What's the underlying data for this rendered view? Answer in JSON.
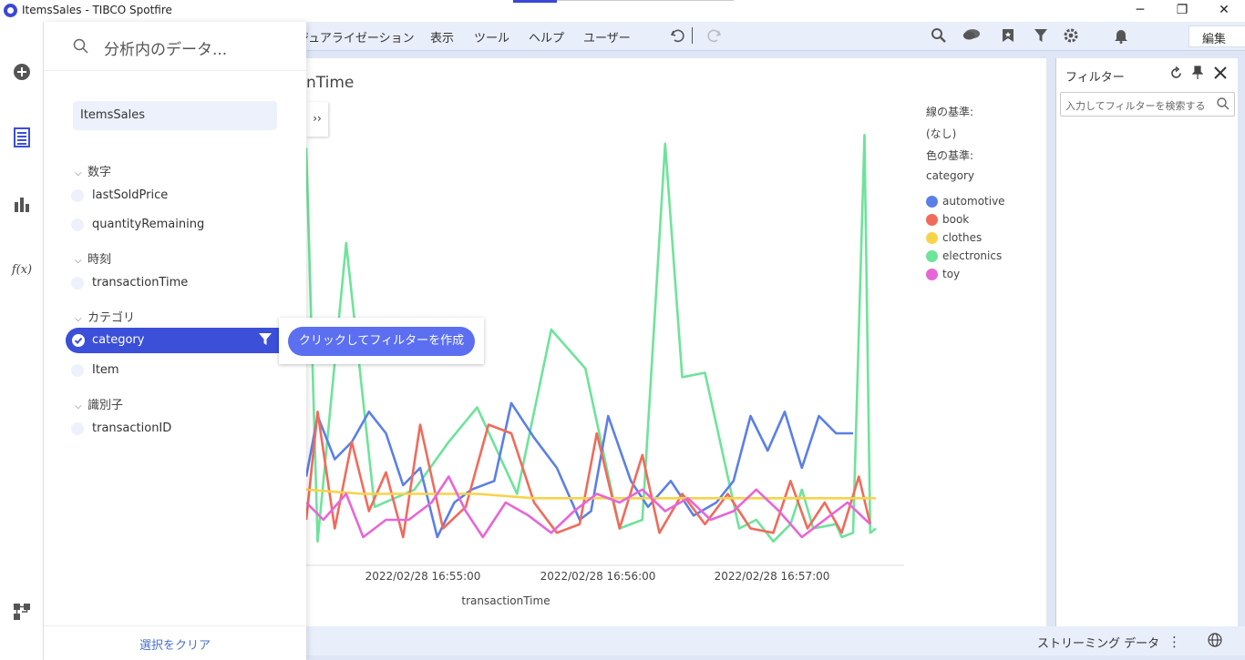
{
  "window": {
    "title": "ItemsSales - TIBCO Spotfire"
  },
  "menu": {
    "items": [
      "ジュアライゼーション",
      "表示",
      "ツール",
      "ヘルプ",
      "ユーザー"
    ],
    "edit_mode": "編集"
  },
  "data_panel": {
    "search_placeholder": "分析内のデータ...",
    "source": "ItemsSales",
    "groups": [
      {
        "label": "数字",
        "fields": [
          "lastSoldPrice",
          "quantityRemaining"
        ]
      },
      {
        "label": "時刻",
        "fields": [
          "transactionTime"
        ]
      },
      {
        "label": "カテゴリ",
        "fields": [
          "category",
          "Item"
        ]
      },
      {
        "label": "識別子",
        "fields": [
          "transactionID"
        ]
      }
    ],
    "selected_field": "category",
    "clear_selection": "選択をクリア"
  },
  "tooltip": {
    "create_filter": "クリックしてフィルターを作成"
  },
  "visualization": {
    "title": "nTime",
    "expand_label": "››",
    "legend": {
      "line_by_label": "線の基準:",
      "line_by_value": "(なし)",
      "color_by_label": "色の基準:",
      "color_by_value": "category"
    }
  },
  "filter_panel": {
    "title": "フィルター",
    "search_placeholder": "入力してフィルターを検索する"
  },
  "statusbar": {
    "streaming": "ストリーミング データ"
  },
  "chart_data": {
    "type": "line",
    "xlabel": "transactionTime",
    "ylabel": "",
    "x_ticks": [
      "2022/02/28 16:55:00",
      "2022/02/28 16:56:00",
      "2022/02/28 16:57:00"
    ],
    "colors": {
      "automotive": "#5b7fe6",
      "book": "#f06b5b",
      "clothes": "#f7d34a",
      "electronics": "#6ee39a",
      "toy": "#e766d6"
    },
    "series": [
      {
        "name": "electronics",
        "points": [
          [
            0,
            0.06
          ],
          [
            0.02,
            0.97
          ],
          [
            0.07,
            0.28
          ],
          [
            0.12,
            0.89
          ],
          [
            0.19,
            0.85
          ],
          [
            0.25,
            0.74
          ],
          [
            0.3,
            0.66
          ],
          [
            0.37,
            0.86
          ],
          [
            0.43,
            0.48
          ],
          [
            0.49,
            0.57
          ],
          [
            0.55,
            0.94
          ],
          [
            0.59,
            0.92
          ],
          [
            0.63,
            0.05
          ],
          [
            0.66,
            0.59
          ],
          [
            0.7,
            0.58
          ],
          [
            0.76,
            0.94
          ],
          [
            0.79,
            0.92
          ],
          [
            0.82,
            0.97
          ],
          [
            0.85,
            0.93
          ],
          [
            0.87,
            0.85
          ],
          [
            0.89,
            0.94
          ],
          [
            0.93,
            0.93
          ],
          [
            0.94,
            0.96
          ],
          [
            0.96,
            0.95
          ],
          [
            0.98,
            0.03
          ],
          [
            0.99,
            0.95
          ],
          [
            1.0,
            0.94
          ]
        ]
      },
      {
        "name": "automotive",
        "points": [
          [
            0,
            0.82
          ],
          [
            0.02,
            0.68
          ],
          [
            0.05,
            0.78
          ],
          [
            0.08,
            0.74
          ],
          [
            0.11,
            0.67
          ],
          [
            0.14,
            0.72
          ],
          [
            0.17,
            0.84
          ],
          [
            0.2,
            0.8
          ],
          [
            0.23,
            0.96
          ],
          [
            0.26,
            0.88
          ],
          [
            0.29,
            0.85
          ],
          [
            0.33,
            0.83
          ],
          [
            0.36,
            0.65
          ],
          [
            0.4,
            0.73
          ],
          [
            0.44,
            0.8
          ],
          [
            0.48,
            0.92
          ],
          [
            0.5,
            0.9
          ],
          [
            0.53,
            0.68
          ],
          [
            0.57,
            0.83
          ],
          [
            0.6,
            0.89
          ],
          [
            0.64,
            0.83
          ],
          [
            0.68,
            0.91
          ],
          [
            0.72,
            0.88
          ],
          [
            0.75,
            0.83
          ],
          [
            0.78,
            0.68
          ],
          [
            0.81,
            0.76
          ],
          [
            0.84,
            0.67
          ],
          [
            0.87,
            0.8
          ],
          [
            0.9,
            0.68
          ],
          [
            0.93,
            0.72
          ],
          [
            0.96,
            0.72
          ]
        ]
      },
      {
        "name": "book",
        "points": [
          [
            0,
            0.92
          ],
          [
            0.02,
            0.67
          ],
          [
            0.05,
            0.94
          ],
          [
            0.08,
            0.74
          ],
          [
            0.11,
            0.9
          ],
          [
            0.14,
            0.81
          ],
          [
            0.17,
            0.96
          ],
          [
            0.2,
            0.7
          ],
          [
            0.24,
            0.94
          ],
          [
            0.28,
            0.89
          ],
          [
            0.32,
            0.7
          ],
          [
            0.36,
            0.72
          ],
          [
            0.4,
            0.88
          ],
          [
            0.44,
            0.95
          ],
          [
            0.48,
            0.93
          ],
          [
            0.51,
            0.72
          ],
          [
            0.55,
            0.94
          ],
          [
            0.59,
            0.77
          ],
          [
            0.62,
            0.95
          ],
          [
            0.66,
            0.86
          ],
          [
            0.7,
            0.93
          ],
          [
            0.74,
            0.86
          ],
          [
            0.78,
            0.94
          ],
          [
            0.82,
            0.95
          ],
          [
            0.85,
            0.83
          ],
          [
            0.88,
            0.94
          ],
          [
            0.91,
            0.88
          ],
          [
            0.94,
            0.95
          ],
          [
            0.97,
            0.82
          ],
          [
            0.99,
            0.93
          ]
        ]
      },
      {
        "name": "clothes",
        "points": [
          [
            0,
            0.85
          ],
          [
            0.1,
            0.86
          ],
          [
            0.2,
            0.86
          ],
          [
            0.3,
            0.86
          ],
          [
            0.4,
            0.87
          ],
          [
            0.5,
            0.87
          ],
          [
            0.6,
            0.87
          ],
          [
            0.7,
            0.87
          ],
          [
            0.8,
            0.87
          ],
          [
            0.9,
            0.87
          ],
          [
            1.0,
            0.87
          ]
        ]
      },
      {
        "name": "toy",
        "points": [
          [
            0,
            0.88
          ],
          [
            0.03,
            0.92
          ],
          [
            0.07,
            0.86
          ],
          [
            0.1,
            0.96
          ],
          [
            0.14,
            0.92
          ],
          [
            0.18,
            0.92
          ],
          [
            0.22,
            0.88
          ],
          [
            0.25,
            0.82
          ],
          [
            0.28,
            0.9
          ],
          [
            0.31,
            0.96
          ],
          [
            0.35,
            0.88
          ],
          [
            0.39,
            0.91
          ],
          [
            0.43,
            0.95
          ],
          [
            0.47,
            0.9
          ],
          [
            0.51,
            0.86
          ],
          [
            0.55,
            0.88
          ],
          [
            0.59,
            0.85
          ],
          [
            0.63,
            0.9
          ],
          [
            0.67,
            0.87
          ],
          [
            0.71,
            0.92
          ],
          [
            0.75,
            0.9
          ],
          [
            0.79,
            0.85
          ],
          [
            0.83,
            0.9
          ],
          [
            0.87,
            0.96
          ],
          [
            0.91,
            0.92
          ],
          [
            0.95,
            0.88
          ],
          [
            0.99,
            0.93
          ]
        ]
      }
    ]
  }
}
